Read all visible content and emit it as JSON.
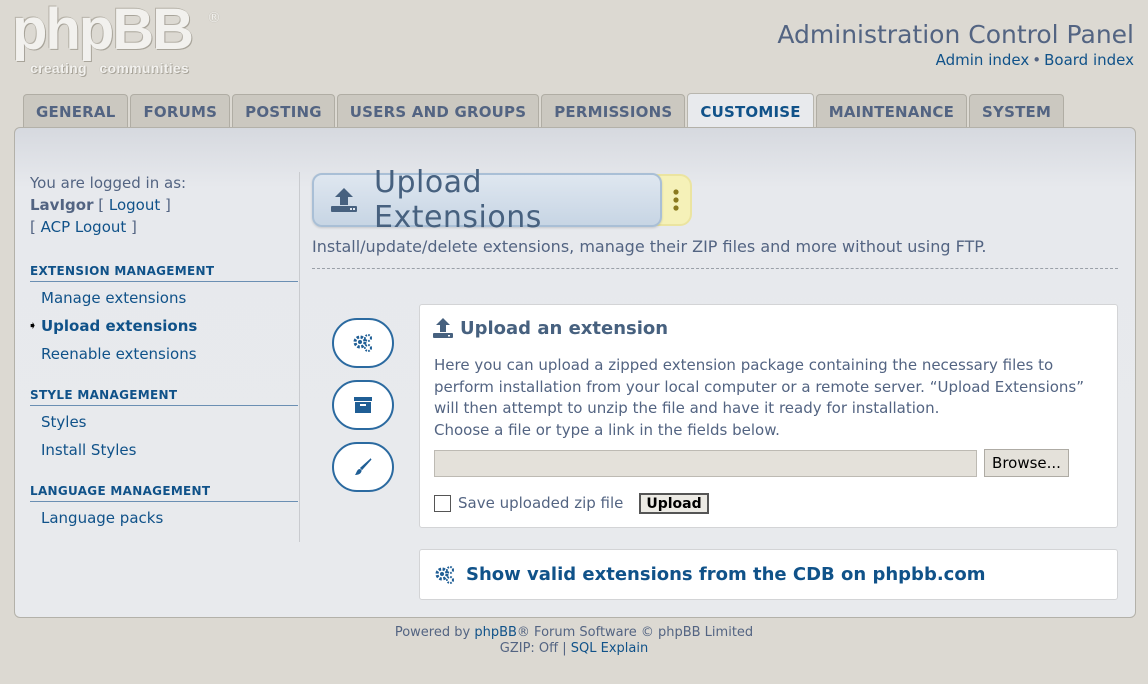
{
  "logo": {
    "main": "phpBB",
    "reg": "®",
    "tagline": "creating   communities"
  },
  "header": {
    "title": "Administration Control Panel",
    "links": {
      "admin_index": "Admin index",
      "separator": "•",
      "board_index": "Board index"
    }
  },
  "tabs": [
    {
      "label": "GENERAL"
    },
    {
      "label": "FORUMS"
    },
    {
      "label": "POSTING"
    },
    {
      "label": "USERS AND GROUPS"
    },
    {
      "label": "PERMISSIONS"
    },
    {
      "label": "CUSTOMISE",
      "active": true
    },
    {
      "label": "MAINTENANCE"
    },
    {
      "label": "SYSTEM"
    }
  ],
  "sidebar": {
    "logged_in_label": "You are logged in as:",
    "username": "LavIgor",
    "logout": "Logout",
    "acp_logout": "ACP Logout",
    "sections": [
      {
        "heading": "EXTENSION MANAGEMENT",
        "items": [
          "Manage extensions",
          "Upload extensions",
          "Reenable extensions"
        ]
      },
      {
        "heading": "STYLE MANAGEMENT",
        "items": [
          "Styles",
          "Install Styles"
        ]
      },
      {
        "heading": "LANGUAGE MANAGEMENT",
        "items": [
          "Language packs"
        ]
      }
    ],
    "active_item": "Upload extensions"
  },
  "page": {
    "title": "Upload Extensions",
    "description": "Install/update/delete extensions, manage their ZIP files and more without using FTP."
  },
  "upload_card": {
    "title": "Upload an extension",
    "text_line1": "Here you can upload a zipped extension package containing the necessary files to",
    "text_line2": "perform installation from your local computer or a remote server. “Upload Extensions”",
    "text_line3": "will then attempt to unzip the file and have it ready for installation.",
    "text_line4": "Choose a file or type a link in the fields below.",
    "file_value": "",
    "browse_label": "Browse...",
    "save_zip_label": "Save uploaded zip file",
    "save_zip_checked": false,
    "upload_label": "Upload"
  },
  "cdb_card": {
    "label": "Show valid extensions from the CDB on phpbb.com"
  },
  "footer": {
    "powered_by": "Powered by",
    "phpbb_link": "phpBB",
    "rest": "® Forum Software © phpBB Limited",
    "gzip": "GZIP: Off |",
    "sql_explain": "SQL Explain"
  },
  "colors": {
    "accent": "#105289",
    "text": "#536482",
    "page_bg": "#dcd9d2"
  }
}
